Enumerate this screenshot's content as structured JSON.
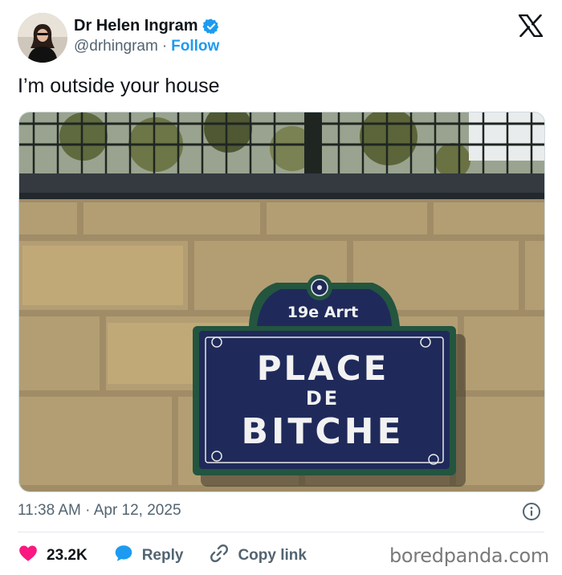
{
  "author": {
    "name": "Dr Helen Ingram",
    "handle": "@drhingram",
    "separator": "·",
    "follow_label": "Follow"
  },
  "tweet": {
    "text": "I’m outside your house",
    "timestamp": "11:38 AM · Apr 12, 2025"
  },
  "sign": {
    "district": "19e Arrt",
    "line1": "PLACE",
    "line2": "DE",
    "line3": "BITCHE"
  },
  "actions": {
    "likes": "23.2K",
    "reply": "Reply",
    "copy_link": "Copy link"
  },
  "watermark": "boredpanda.com",
  "colors": {
    "accent": "#1d9bf0",
    "like": "#f91880",
    "muted": "#536471",
    "sign_blue": "#1f2a5a"
  },
  "icons": {
    "verified": "verified-badge-icon",
    "logo": "x-logo-icon",
    "info": "info-icon",
    "like": "heart-icon",
    "reply": "speech-bubble-icon",
    "copy": "link-icon"
  }
}
